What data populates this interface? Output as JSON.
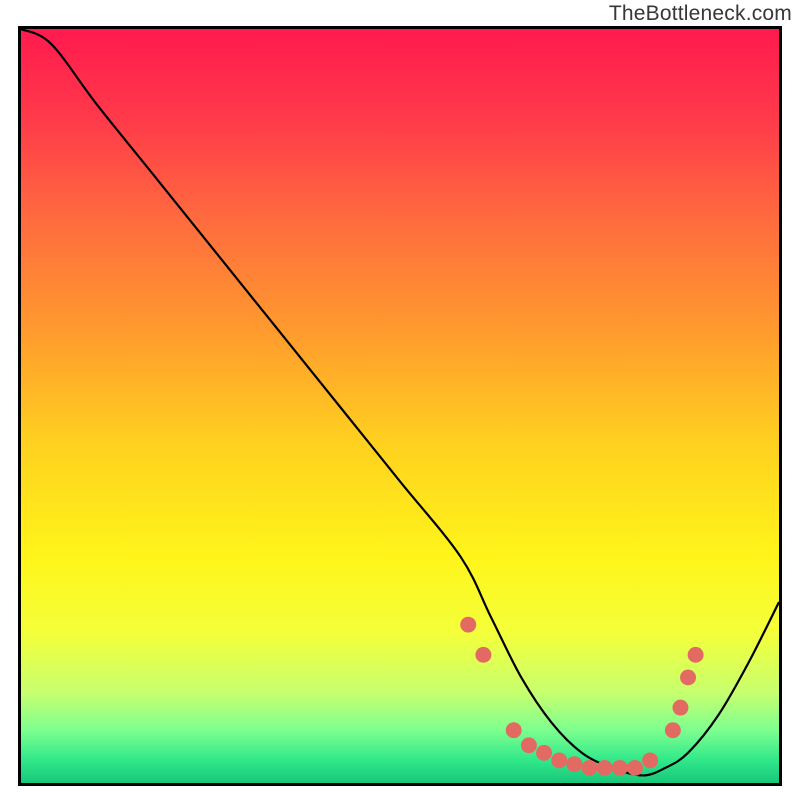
{
  "watermark": "TheBottleneck.com",
  "chart_data": {
    "type": "line",
    "title": "",
    "xlabel": "",
    "ylabel": "",
    "xlim": [
      0,
      100
    ],
    "ylim": [
      0,
      100
    ],
    "grid": false,
    "legend": false,
    "background": {
      "type": "vertical-gradient",
      "note": "gradient top→bottom; values approximate stop positions 0–1",
      "stops": [
        {
          "pos": 0.0,
          "color": "#ff1a4e"
        },
        {
          "pos": 0.12,
          "color": "#ff3a4a"
        },
        {
          "pos": 0.25,
          "color": "#ff6a3f"
        },
        {
          "pos": 0.4,
          "color": "#ff9a2e"
        },
        {
          "pos": 0.55,
          "color": "#ffd11f"
        },
        {
          "pos": 0.7,
          "color": "#fff51a"
        },
        {
          "pos": 0.8,
          "color": "#f4ff3a"
        },
        {
          "pos": 0.88,
          "color": "#c7ff6e"
        },
        {
          "pos": 0.93,
          "color": "#7dff8f"
        },
        {
          "pos": 0.97,
          "color": "#30e88a"
        },
        {
          "pos": 1.0,
          "color": "#18c77a"
        }
      ]
    },
    "series": [
      {
        "name": "bottleneck-curve",
        "color": "#000000",
        "x": [
          0,
          4,
          10,
          18,
          26,
          34,
          42,
          50,
          58,
          62,
          66,
          70,
          74,
          78,
          82,
          85,
          88,
          92,
          96,
          100
        ],
        "y": [
          100,
          98,
          90,
          80,
          70,
          60,
          50,
          40,
          30,
          22,
          14,
          8,
          4,
          2,
          1,
          2,
          4,
          9,
          16,
          24
        ]
      }
    ],
    "markers": {
      "name": "optimum-dots",
      "color": "#e26a63",
      "radius": 8,
      "points": [
        {
          "x": 59,
          "y": 21
        },
        {
          "x": 61,
          "y": 17
        },
        {
          "x": 65,
          "y": 7
        },
        {
          "x": 67,
          "y": 5
        },
        {
          "x": 69,
          "y": 4
        },
        {
          "x": 71,
          "y": 3
        },
        {
          "x": 73,
          "y": 2.5
        },
        {
          "x": 75,
          "y": 2
        },
        {
          "x": 77,
          "y": 2
        },
        {
          "x": 79,
          "y": 2
        },
        {
          "x": 81,
          "y": 2
        },
        {
          "x": 83,
          "y": 3
        },
        {
          "x": 86,
          "y": 7
        },
        {
          "x": 87,
          "y": 10
        },
        {
          "x": 88,
          "y": 14
        },
        {
          "x": 89,
          "y": 17
        }
      ]
    }
  }
}
